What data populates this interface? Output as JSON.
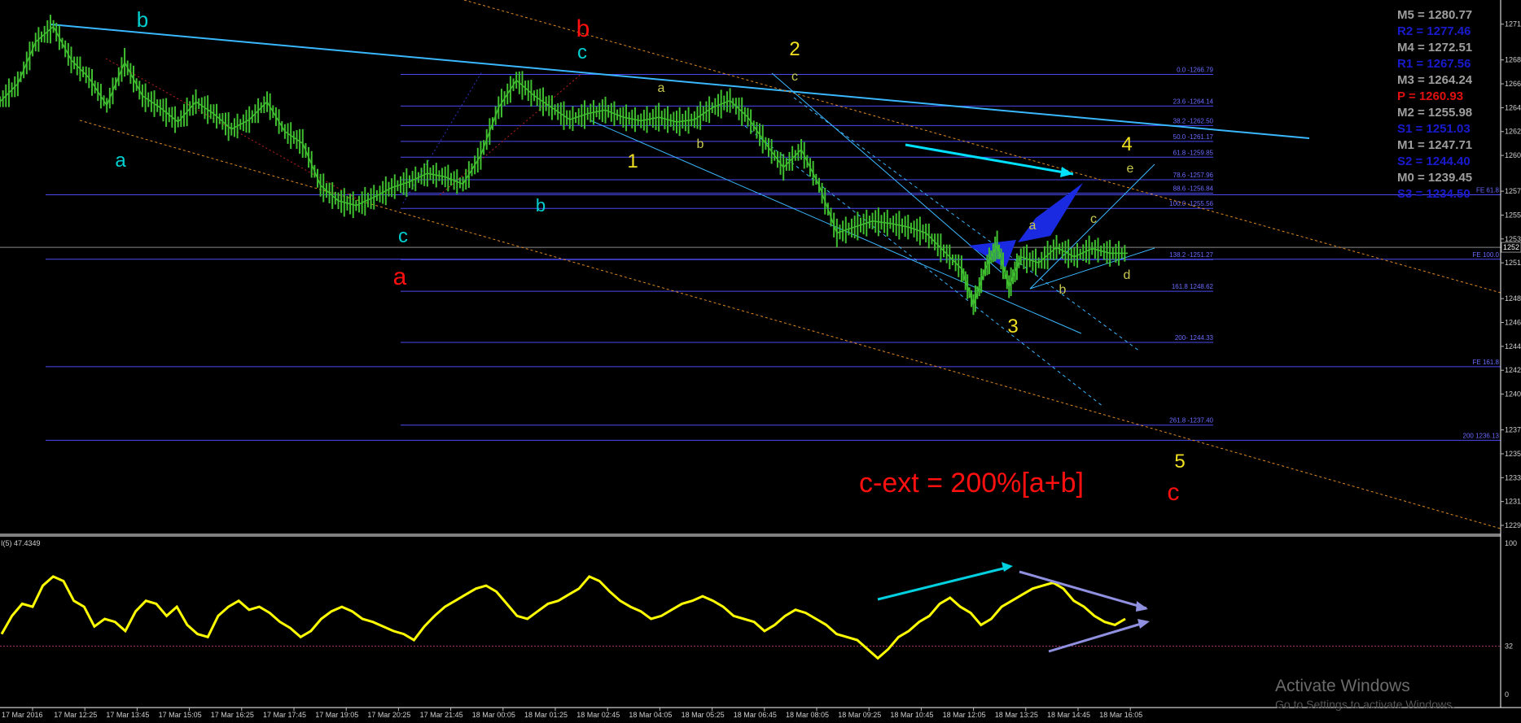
{
  "chart_data": [
    {
      "type": "line",
      "title": "",
      "xlabel": "",
      "ylabel": "",
      "ylim": [
        1229,
        1272
      ],
      "yticks": [
        "1271",
        "1268",
        "1266",
        "1264",
        "1262",
        "1260",
        "1257",
        "1255",
        "1253",
        "1251",
        "1248",
        "1246",
        "1244",
        "1242",
        "1240",
        "1237",
        "1235",
        "1233",
        "1231",
        "1229"
      ],
      "current_price_label": "1252",
      "x_labels": [
        "17 Mar 2016",
        "17 Mar 12:25",
        "17 Mar 13:45",
        "17 Mar 15:05",
        "17 Mar 16:25",
        "17 Mar 17:45",
        "17 Mar 19:05",
        "17 Mar 20:25",
        "17 Mar 21:45",
        "18 Mar 00:05",
        "18 Mar 01:25",
        "18 Mar 02:45",
        "18 Mar 04:05",
        "18 Mar 05:25",
        "18 Mar 06:45",
        "18 Mar 08:05",
        "18 Mar 09:25",
        "18 Mar 10:45",
        "18 Mar 12:05",
        "18 Mar 13:25",
        "18 Mar 14:45",
        "18 Mar 16:05"
      ],
      "price_path": [
        [
          0,
          1264.5
        ],
        [
          3,
          1266
        ],
        [
          6,
          1269.5
        ],
        [
          9,
          1270.8
        ],
        [
          12,
          1268
        ],
        [
          15,
          1266.5
        ],
        [
          18,
          1264.2
        ],
        [
          21,
          1267.8
        ],
        [
          24,
          1265
        ],
        [
          27,
          1264
        ],
        [
          30,
          1262.8
        ],
        [
          33,
          1264.5
        ],
        [
          36,
          1263.5
        ],
        [
          39,
          1262.2
        ],
        [
          42,
          1263
        ],
        [
          45,
          1264.5
        ],
        [
          48,
          1262
        ],
        [
          51,
          1261
        ],
        [
          54,
          1257.5
        ],
        [
          57,
          1256.2
        ],
        [
          60,
          1255.8
        ],
        [
          63,
          1256.5
        ],
        [
          66,
          1257.3
        ],
        [
          69,
          1257.8
        ],
        [
          72,
          1258.5
        ],
        [
          75,
          1258.2
        ],
        [
          78,
          1257.6
        ],
        [
          81,
          1260
        ],
        [
          84,
          1264
        ],
        [
          87,
          1266.3
        ],
        [
          90,
          1265
        ],
        [
          93,
          1264
        ],
        [
          96,
          1263
        ],
        [
          99,
          1263.5
        ],
        [
          102,
          1263.8
        ],
        [
          105,
          1263.2
        ],
        [
          108,
          1262.9
        ],
        [
          111,
          1263.2
        ],
        [
          114,
          1262.8
        ],
        [
          117,
          1263
        ],
        [
          120,
          1264
        ],
        [
          123,
          1264.6
        ],
        [
          126,
          1263.2
        ],
        [
          129,
          1261
        ],
        [
          132,
          1259
        ],
        [
          135,
          1260.5
        ],
        [
          138,
          1257.5
        ],
        [
          141,
          1253.5
        ],
        [
          144,
          1254
        ],
        [
          147,
          1254.5
        ],
        [
          150,
          1254.3
        ],
        [
          153,
          1254
        ],
        [
          156,
          1253.5
        ],
        [
          159,
          1252
        ],
        [
          162,
          1250.5
        ],
        [
          164,
          1247.5
        ],
        [
          166,
          1250.5
        ],
        [
          168,
          1252.5
        ],
        [
          170,
          1249
        ],
        [
          172,
          1251.5
        ],
        [
          175,
          1251
        ],
        [
          178,
          1252.3
        ],
        [
          181,
          1251.5
        ],
        [
          184,
          1252.2
        ],
        [
          187,
          1251.8
        ],
        [
          190,
          1251.8
        ]
      ],
      "fibonacci_retracement": [
        {
          "label": "0.0 -1266.79",
          "price": 1266.79
        },
        {
          "label": "23.6 -1264.14",
          "price": 1264.14
        },
        {
          "label": "38.2 -1262.50",
          "price": 1262.5
        },
        {
          "label": "50.0 -1261.17",
          "price": 1261.17
        },
        {
          "label": "61.8 -1259.85",
          "price": 1259.85
        },
        {
          "label": "78.6 -1257.96",
          "price": 1257.96
        },
        {
          "label": "88.6 -1256.84",
          "price": 1256.84
        },
        {
          "label": "100.0 -1255.56",
          "price": 1255.56
        },
        {
          "label": "138.2 -1251.27",
          "price": 1251.27
        },
        {
          "label": "161.8 1248.62",
          "price": 1248.62
        },
        {
          "label": "200- 1244.33",
          "price": 1244.33
        },
        {
          "label": "261.8 -1237.40",
          "price": 1237.4
        }
      ],
      "fibonacci_expansion": [
        {
          "label": "FE 61.8",
          "price": 1256.7
        },
        {
          "label": "FE 100.0",
          "price": 1251.3
        },
        {
          "label": "FE 161.8",
          "price": 1242.3
        },
        {
          "label": "200 1236.13",
          "price": 1236.13
        }
      ],
      "pivot_levels": [
        {
          "label": "M5 = 1280.77",
          "color": "#9e9e9e"
        },
        {
          "label": "R2 = 1277.46",
          "color": "#1a1acd"
        },
        {
          "label": "M4 = 1272.51",
          "color": "#9e9e9e"
        },
        {
          "label": "R1 = 1267.56",
          "color": "#1a1acd"
        },
        {
          "label": "M3 = 1264.24",
          "color": "#9e9e9e"
        },
        {
          "label": "P  = 1260.93",
          "color": "#e01010"
        },
        {
          "label": "M2 = 1255.98",
          "color": "#9e9e9e"
        },
        {
          "label": "S1 = 1251.03",
          "color": "#1a1acd"
        },
        {
          "label": "M1 = 1247.71",
          "color": "#9e9e9e"
        },
        {
          "label": "S2 = 1244.40",
          "color": "#1a1acd"
        },
        {
          "label": "M0 = 1239.45",
          "color": "#9e9e9e"
        },
        {
          "label": "S3 = 1234.50",
          "color": "#1a1acd"
        }
      ],
      "wave_labels": [
        {
          "text": "b",
          "color": "#00d0d0"
        },
        {
          "text": "a",
          "color": "#00d0d0"
        },
        {
          "text": "c",
          "color": "#00d0d0"
        },
        {
          "text": "b",
          "color": "#00d0d0"
        },
        {
          "text": "c",
          "color": "#00d0d0"
        },
        {
          "text": "a",
          "color": "#ff1010"
        },
        {
          "text": "b",
          "color": "#ff1010"
        },
        {
          "text": "c",
          "color": "#ff1010"
        },
        {
          "text": "1",
          "color": "#f0e020"
        },
        {
          "text": "2",
          "color": "#f0e020"
        },
        {
          "text": "3",
          "color": "#f0e020"
        },
        {
          "text": "4",
          "color": "#f0e020"
        },
        {
          "text": "5",
          "color": "#f0e020"
        },
        {
          "text": "a",
          "color": "#c8c850"
        },
        {
          "text": "b",
          "color": "#c8c850"
        },
        {
          "text": "c",
          "color": "#c8c850"
        },
        {
          "text": "a",
          "color": "#c8c850"
        },
        {
          "text": "b",
          "color": "#c8c850"
        },
        {
          "text": "c",
          "color": "#c8c850"
        },
        {
          "text": "d",
          "color": "#c8c850"
        },
        {
          "text": "e",
          "color": "#c8c850"
        }
      ],
      "annotation": "c-ext = 200%[a+b]",
      "colors": {
        "candles": "#3fbf2f",
        "channel": "#00bfff",
        "fib": "#5a5aff",
        "dotted": "#e08a20",
        "red_dotted": "#c02020",
        "annotation": "#ff1010"
      }
    },
    {
      "type": "line",
      "title": "",
      "indicator_label": "I(5) 47.4349",
      "ylim": [
        0,
        100
      ],
      "yticks": [
        "100",
        "32",
        "0"
      ],
      "reference_level": 32,
      "values": [
        40,
        52,
        60,
        58,
        72,
        78,
        75,
        62,
        58,
        45,
        50,
        48,
        42,
        55,
        62,
        60,
        52,
        58,
        46,
        40,
        38,
        52,
        58,
        62,
        56,
        58,
        54,
        48,
        44,
        38,
        42,
        50,
        55,
        58,
        55,
        50,
        48,
        45,
        42,
        40,
        36,
        45,
        52,
        58,
        62,
        66,
        70,
        72,
        68,
        60,
        52,
        50,
        55,
        60,
        62,
        66,
        70,
        78,
        75,
        68,
        62,
        58,
        55,
        50,
        52,
        56,
        60,
        62,
        65,
        62,
        58,
        52,
        50,
        48,
        42,
        46,
        52,
        56,
        54,
        50,
        46,
        40,
        38,
        36,
        30,
        24,
        30,
        38,
        42,
        48,
        52,
        60,
        64,
        58,
        54,
        46,
        50,
        58,
        62,
        66,
        70,
        72,
        74,
        70,
        62,
        58,
        52,
        48,
        46,
        50
      ],
      "colors": {
        "line": "#ffff00",
        "arrow": "#00d0e0",
        "triangle": "#9090e0",
        "ref": "#a0306a"
      }
    }
  ],
  "watermark": {
    "title": "Activate Windows",
    "subtitle": "Go to Settings to activate Windows."
  }
}
